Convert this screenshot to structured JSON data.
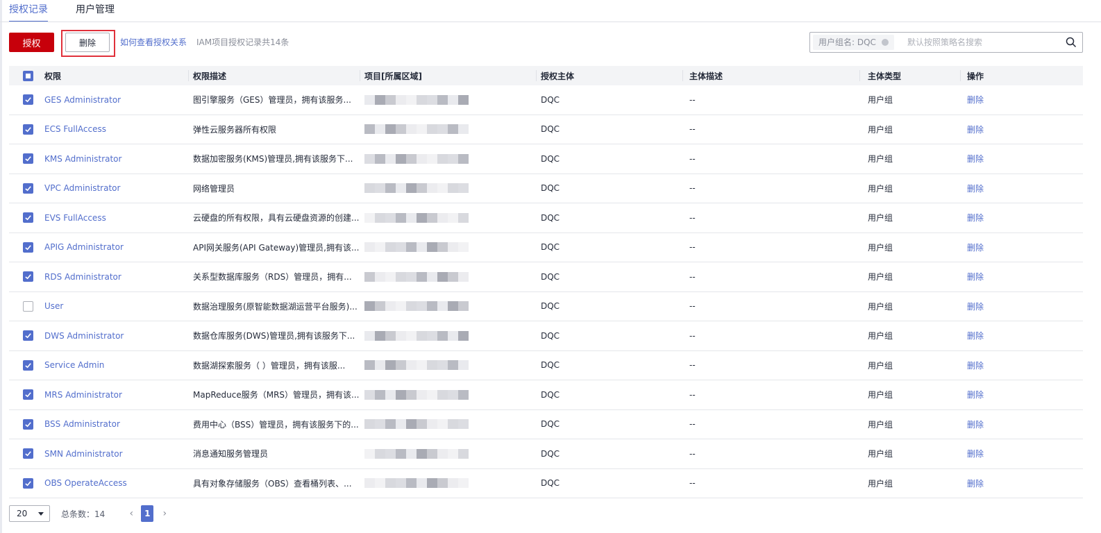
{
  "tabs": [
    {
      "label": "授权记录",
      "active": true
    },
    {
      "label": "用户管理",
      "active": false
    }
  ],
  "toolbar": {
    "grant_label": "授权",
    "delete_label": "删除",
    "help_link": "如何查看授权关系",
    "count_text": "IAM项目授权记录共14条"
  },
  "search": {
    "tag": "用户组名: DQC",
    "placeholder": "默认按照策略名搜索"
  },
  "table": {
    "headers": [
      "权限",
      "权限描述",
      "项目[所属区域]",
      "授权主体",
      "主体描述",
      "主体类型",
      "操作"
    ],
    "rows": [
      {
        "checked": true,
        "perm": "GES Administrator",
        "desc": "图引擎服务（GES）管理员，拥有该服务...",
        "subject": "DQC",
        "sdesc": "--",
        "type": "用户组",
        "op": "删除"
      },
      {
        "checked": true,
        "perm": "ECS FullAccess",
        "desc": "弹性云服务器所有权限",
        "subject": "DQC",
        "sdesc": "--",
        "type": "用户组",
        "op": "删除"
      },
      {
        "checked": true,
        "perm": "KMS Administrator",
        "desc": "数据加密服务(KMS)管理员,拥有该服务下...",
        "subject": "DQC",
        "sdesc": "--",
        "type": "用户组",
        "op": "删除"
      },
      {
        "checked": true,
        "perm": "VPC Administrator",
        "desc": "网络管理员",
        "subject": "DQC",
        "sdesc": "--",
        "type": "用户组",
        "op": "删除"
      },
      {
        "checked": true,
        "perm": "EVS FullAccess",
        "desc": "云硬盘的所有权限，具有云硬盘资源的创建...",
        "subject": "DQC",
        "sdesc": "--",
        "type": "用户组",
        "op": "删除"
      },
      {
        "checked": true,
        "perm": "APIG Administrator",
        "desc": "API网关服务(API Gateway)管理员,拥有该...",
        "subject": "DQC",
        "sdesc": "--",
        "type": "用户组",
        "op": "删除"
      },
      {
        "checked": true,
        "perm": "RDS Administrator",
        "desc": "关系型数据库服务（RDS）管理员，拥有...",
        "subject": "DQC",
        "sdesc": "--",
        "type": "用户组",
        "op": "删除"
      },
      {
        "checked": false,
        "perm": "User",
        "desc": "数据治理服务(原智能数据湖运营平台服务)...",
        "subject": "DQC",
        "sdesc": "--",
        "type": "用户组",
        "op": "删除"
      },
      {
        "checked": true,
        "perm": "DWS Administrator",
        "desc": "数据仓库服务(DWS)管理员,拥有该服务下...",
        "subject": "DQC",
        "sdesc": "--",
        "type": "用户组",
        "op": "删除"
      },
      {
        "checked": true,
        "perm": "Service Admin",
        "desc": "数据湖探索服务（ ）管理员，拥有该服...",
        "subject": "DQC",
        "sdesc": "--",
        "type": "用户组",
        "op": "删除"
      },
      {
        "checked": true,
        "perm": "MRS Administrator",
        "desc": "MapReduce服务（MRS）管理员，拥有该...",
        "subject": "DQC",
        "sdesc": "--",
        "type": "用户组",
        "op": "删除"
      },
      {
        "checked": true,
        "perm": "BSS Administrator",
        "desc": "费用中心（BSS）管理员，拥有该服务下的...",
        "subject": "DQC",
        "sdesc": "--",
        "type": "用户组",
        "op": "删除"
      },
      {
        "checked": true,
        "perm": "SMN Administrator",
        "desc": "消息通知服务管理员",
        "subject": "DQC",
        "sdesc": "--",
        "type": "用户组",
        "op": "删除"
      },
      {
        "checked": true,
        "perm": "OBS OperateAccess",
        "desc": "具有对象存储服务（OBS）查看桶列表、...",
        "subject": "DQC",
        "sdesc": "--",
        "type": "用户组",
        "op": "删除"
      }
    ]
  },
  "pagination": {
    "page_size": "20",
    "total_label": "总条数：14",
    "current_page": "1"
  },
  "colors": {
    "accent": "#526ecc",
    "primary_button": "#c7000b",
    "highlight_box": "#e0303a"
  }
}
